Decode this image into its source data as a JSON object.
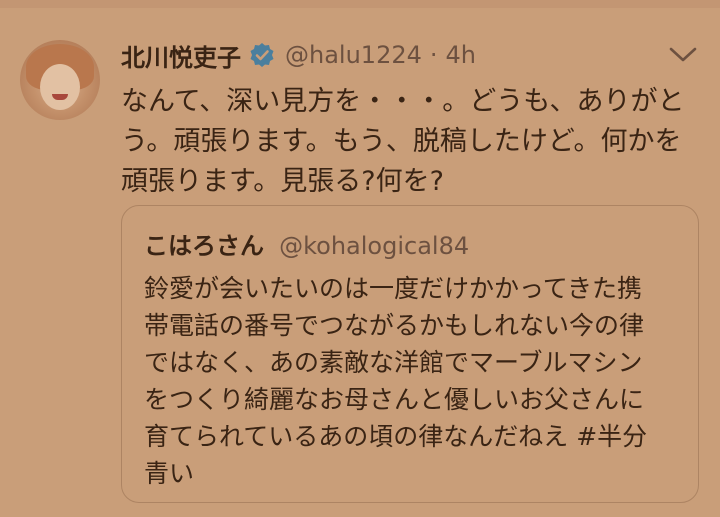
{
  "tweet": {
    "author_name": "北川悦吏子",
    "author_handle": "@halu1224",
    "separator": "·",
    "time": "4h",
    "verified_icon": "verified-badge-icon",
    "menu_icon": "chevron-down-icon",
    "text_lines": [
      "なんて、深い見方を・・・。どうも、ありがと",
      "う。頑張ります。もう、脱稿したけど。何かを",
      "頑張ります。見張る?何を?"
    ]
  },
  "quote": {
    "author_name": "こはろさん",
    "author_handle": "@kohalogical84",
    "text_lines": [
      "鈴愛が会いたいのは一度だけかかってきた携",
      "帯電話の番号でつながるかもしれない今の律",
      "ではなく、あの素敵な洋館でマーブルマシン",
      "をつくり綺麗なお母さんと優しいお父さんに",
      "育てられているあの頃の律なんだねえ #半分",
      "青い"
    ]
  },
  "colors": {
    "background": "#c99e79",
    "text": "#3a2414",
    "secondary_text": "#6d5140",
    "verified": "#4a7f9e",
    "border": "#ad8463"
  }
}
